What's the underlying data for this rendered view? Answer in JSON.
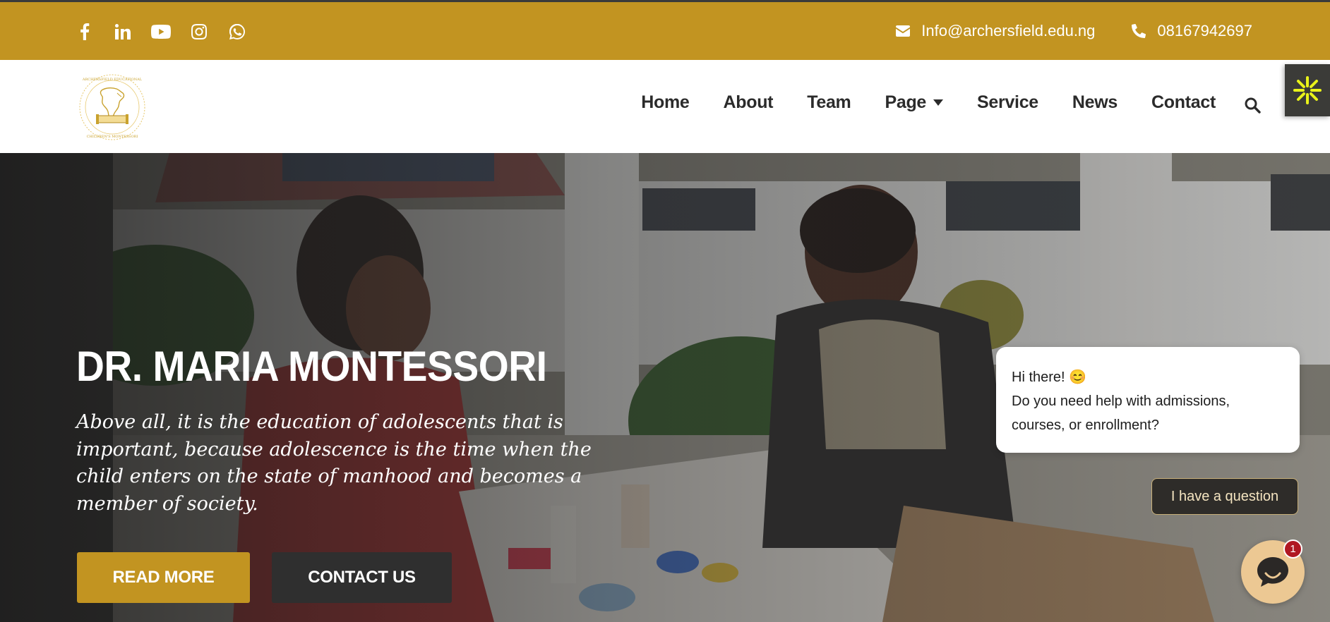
{
  "topbar": {
    "social_icons": [
      "facebook-icon",
      "linkedin-icon",
      "youtube-icon",
      "instagram-icon",
      "whatsapp-icon"
    ],
    "email": "Info@archersfield.edu.ng",
    "phone": "08167942697"
  },
  "nav": {
    "items": [
      {
        "label": "Home"
      },
      {
        "label": "About"
      },
      {
        "label": "Team"
      },
      {
        "label": "Page",
        "has_dropdown": true
      },
      {
        "label": "Service"
      },
      {
        "label": "News"
      },
      {
        "label": "Contact"
      }
    ]
  },
  "hero": {
    "title": "DR. MARIA MONTESSORI",
    "quote": "Above all, it is the education of adolescents that is important, because adolescence is the time when the child enters on the state of manhood and becomes a member of society.",
    "read_more": "READ MORE",
    "contact_us": "CONTACT US"
  },
  "chat": {
    "greeting": "Hi there! 😊",
    "message": "Do you need help with admissions, courses, or enrollment?",
    "question_button": "I have a question",
    "badge_count": "1"
  },
  "colors": {
    "brand_gold": "#c29421",
    "dark": "#2f2f2f",
    "chat_launcher": "#ecc893",
    "badge": "#b01822"
  }
}
